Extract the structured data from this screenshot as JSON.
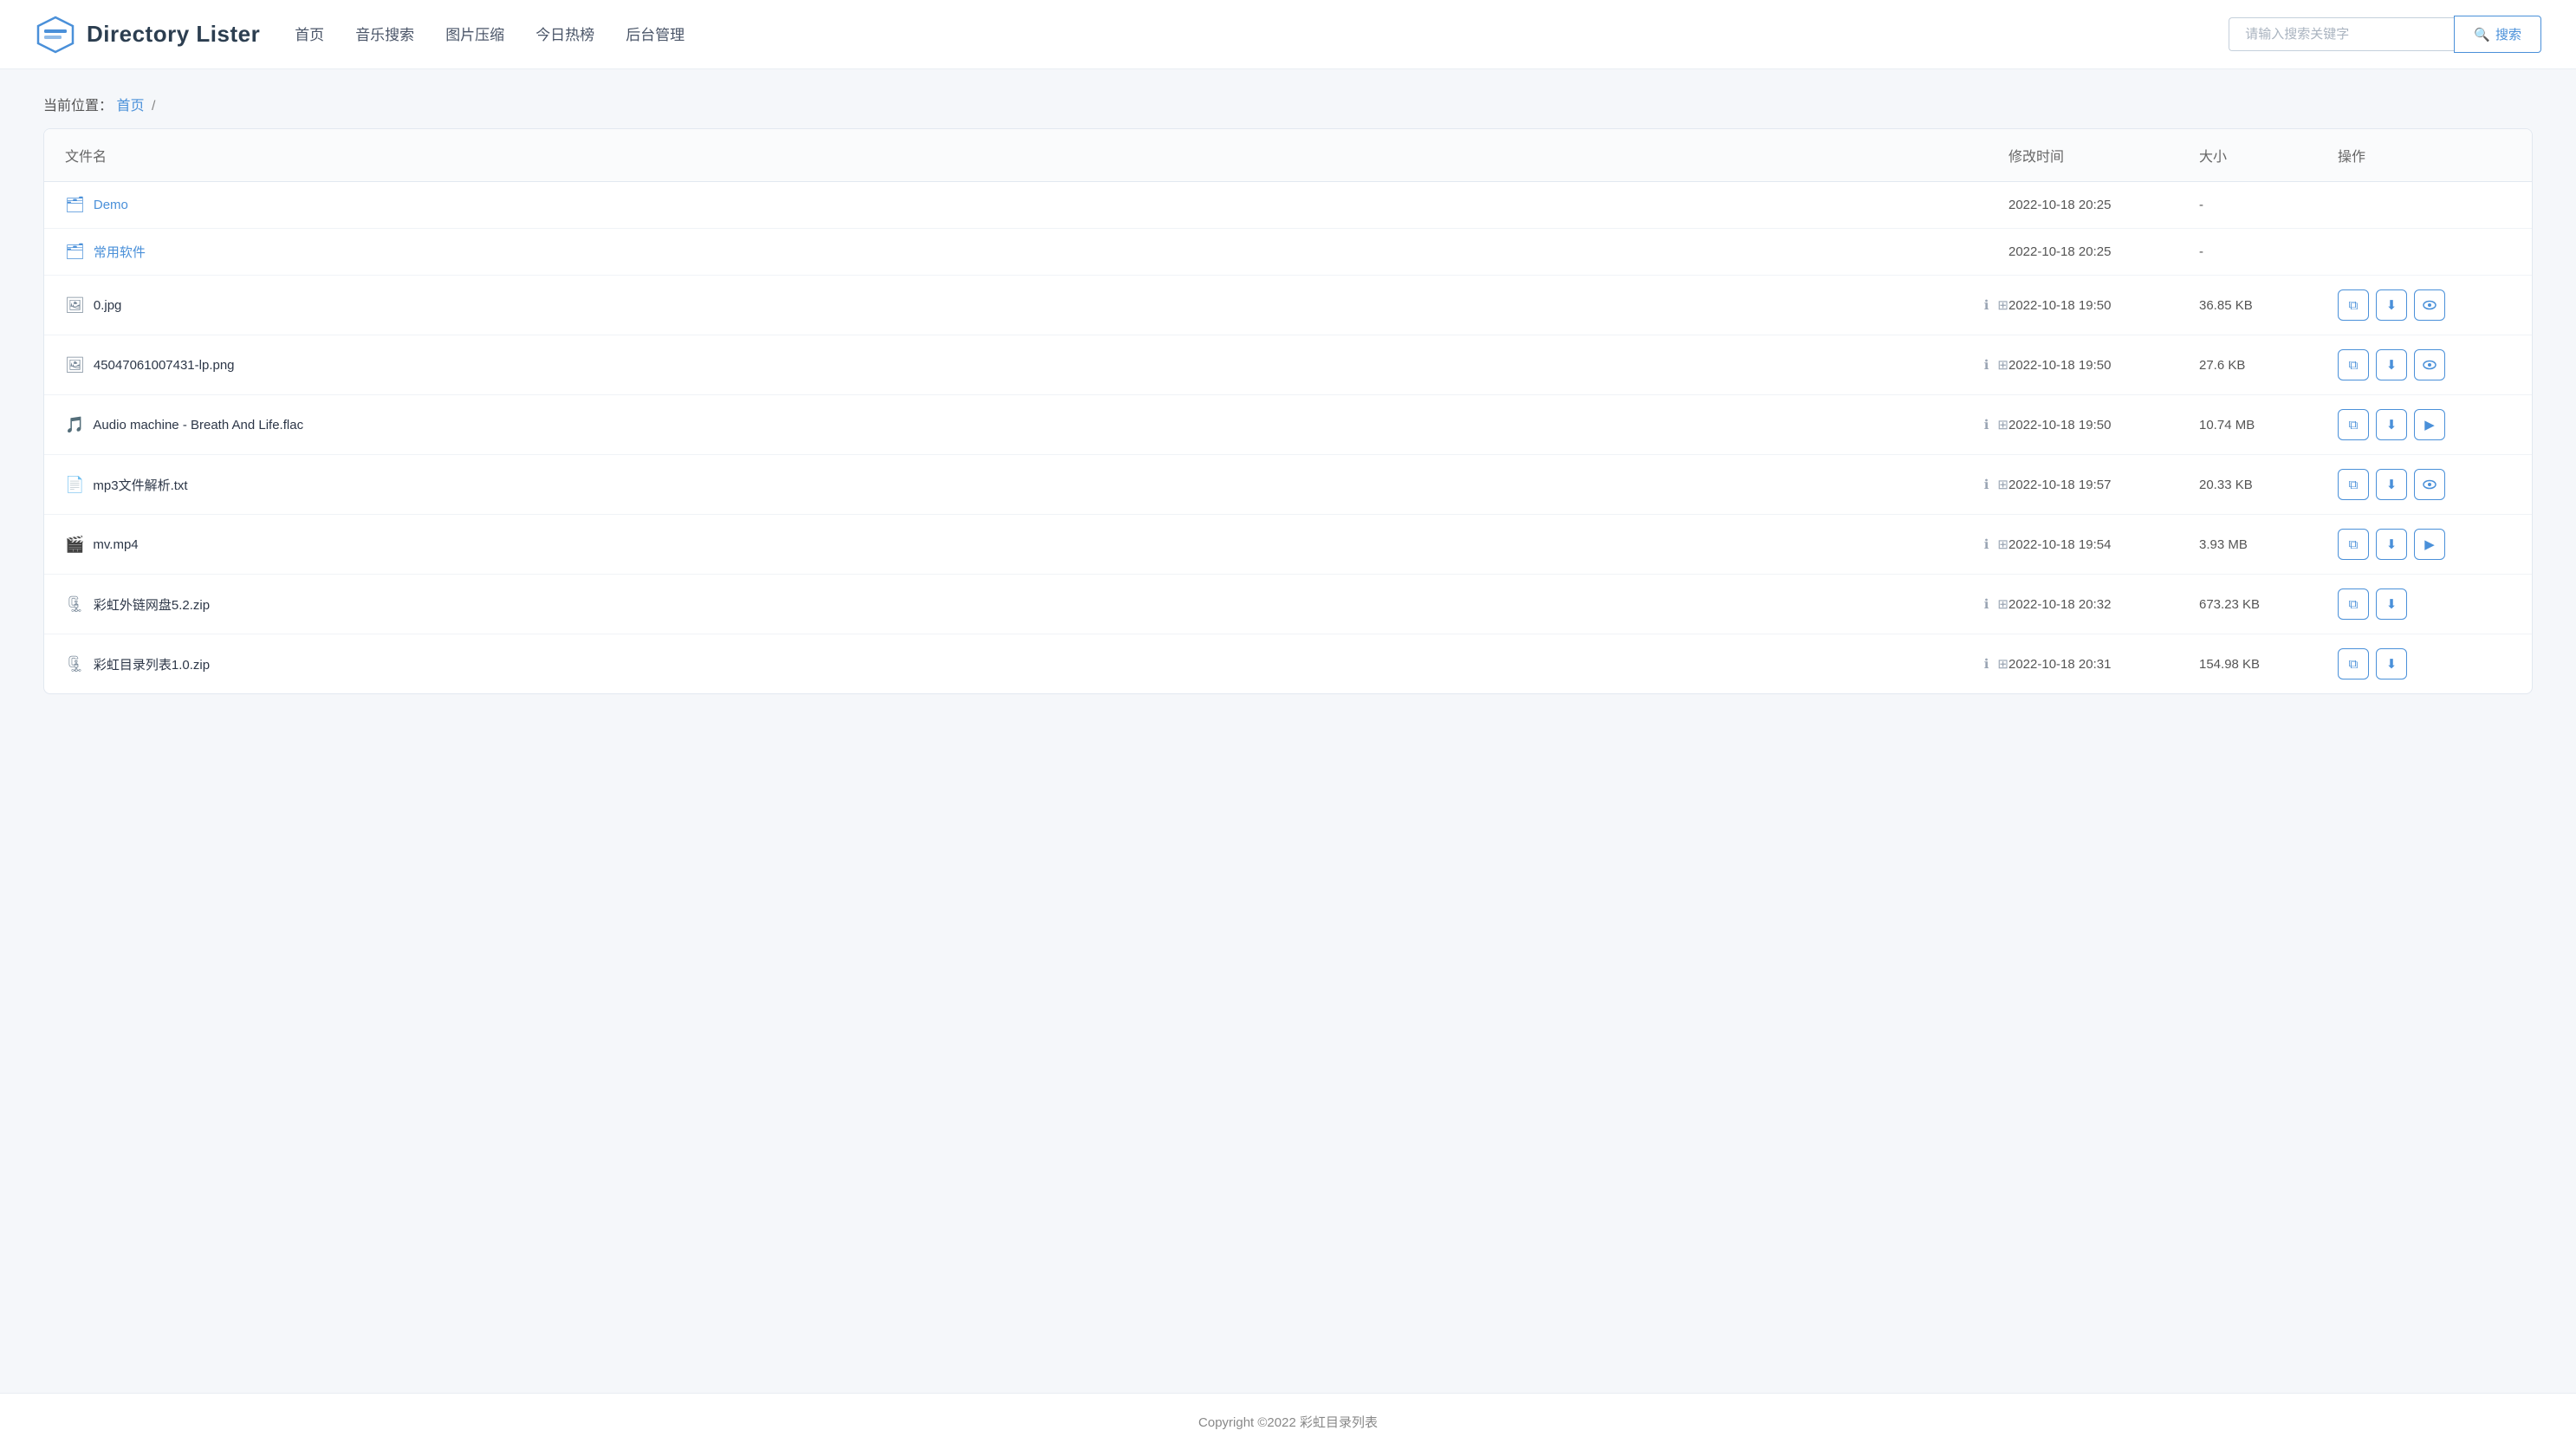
{
  "header": {
    "logo_text": "Directory Lister",
    "nav_items": [
      "首页",
      "音乐搜索",
      "图片压缩",
      "今日热榜",
      "后台管理"
    ],
    "search_placeholder": "请输入搜索关键字",
    "search_btn_label": "搜索"
  },
  "breadcrumb": {
    "label": "当前位置：",
    "home_link": "首页",
    "separator": "/"
  },
  "table": {
    "columns": [
      "文件名",
      "修改时间",
      "大小",
      "操作"
    ],
    "rows": [
      {
        "type": "folder",
        "name": "Demo",
        "modified": "2022-10-18 20:25",
        "size": "-",
        "has_info": false,
        "has_qr": false,
        "actions": []
      },
      {
        "type": "folder",
        "name": "常用软件",
        "modified": "2022-10-18 20:25",
        "size": "-",
        "has_info": false,
        "has_qr": false,
        "actions": []
      },
      {
        "type": "file",
        "name": "0.jpg",
        "modified": "2022-10-18 19:50",
        "size": "36.85 KB",
        "has_info": true,
        "has_qr": true,
        "actions": [
          "copy",
          "download",
          "view"
        ]
      },
      {
        "type": "file",
        "name": "45047061007431-lp.png",
        "modified": "2022-10-18 19:50",
        "size": "27.6 KB",
        "has_info": true,
        "has_qr": true,
        "actions": [
          "copy",
          "download",
          "view"
        ]
      },
      {
        "type": "file",
        "name": "Audio machine - Breath And Life.flac",
        "modified": "2022-10-18 19:50",
        "size": "10.74 MB",
        "has_info": true,
        "has_qr": true,
        "actions": [
          "copy",
          "download",
          "play"
        ]
      },
      {
        "type": "file",
        "name": "mp3文件解析.txt",
        "modified": "2022-10-18 19:57",
        "size": "20.33 KB",
        "has_info": true,
        "has_qr": true,
        "actions": [
          "copy",
          "download",
          "view"
        ]
      },
      {
        "type": "file",
        "name": "mv.mp4",
        "modified": "2022-10-18 19:54",
        "size": "3.93 MB",
        "has_info": true,
        "has_qr": true,
        "actions": [
          "copy",
          "download",
          "play"
        ]
      },
      {
        "type": "file",
        "name": "彩虹外链网盘5.2.zip",
        "modified": "2022-10-18 20:32",
        "size": "673.23 KB",
        "has_info": true,
        "has_qr": true,
        "actions": [
          "copy",
          "download"
        ]
      },
      {
        "type": "file",
        "name": "彩虹目录列表1.0.zip",
        "modified": "2022-10-18 20:31",
        "size": "154.98 KB",
        "has_info": true,
        "has_qr": true,
        "actions": [
          "copy",
          "download"
        ]
      }
    ]
  },
  "footer": {
    "text": "Copyright ©2022 彩虹目录列表"
  },
  "icons": {
    "folder": "📁",
    "file": "📄",
    "search": "🔍",
    "copy": "⧉",
    "download": "⬇",
    "view": "👁",
    "play": "▶",
    "info": "ℹ",
    "qr": "⊞"
  }
}
